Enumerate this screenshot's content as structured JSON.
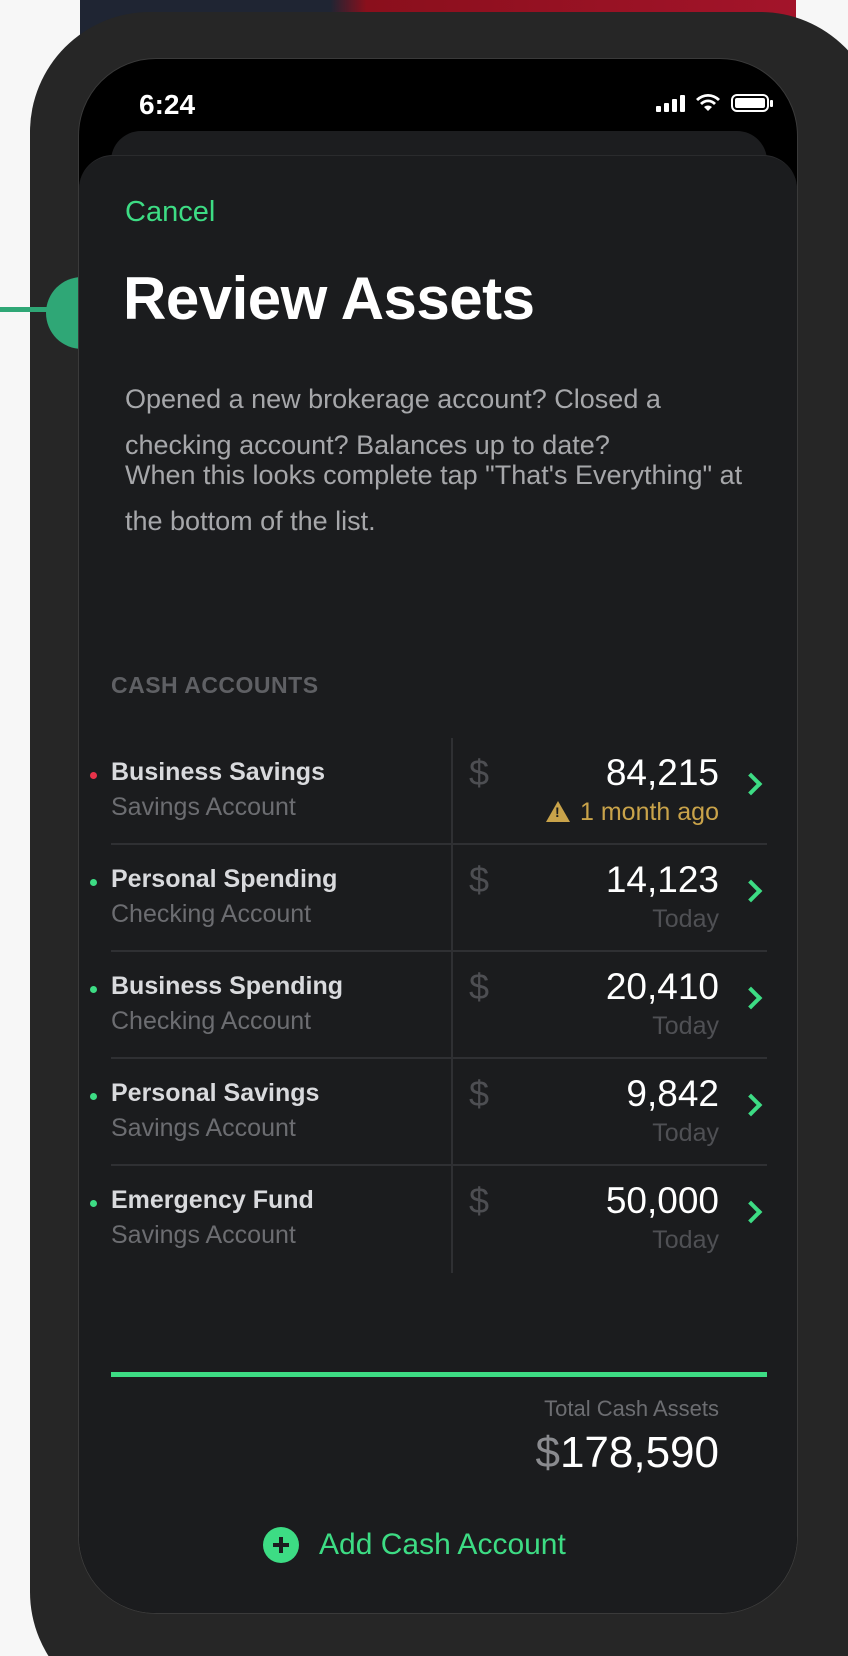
{
  "status_bar": {
    "time": "6:24"
  },
  "nav": {
    "cancel_label": "Cancel"
  },
  "page": {
    "title": "Review Assets",
    "description_1": "Opened a new brokerage account? Closed a checking account? Balances up to date?",
    "description_2": "When this looks complete tap \"That's Everything\" at the bottom of the list."
  },
  "cash_accounts": {
    "header": "CASH ACCOUNTS",
    "currency_symbol": "$",
    "items": [
      {
        "name": "Business Savings",
        "type": "Savings Account",
        "amount": "84,215",
        "updated": "1 month ago",
        "stale": true,
        "bullet_color": "#e8334a"
      },
      {
        "name": "Personal Spending",
        "type": "Checking Account",
        "amount": "14,123",
        "updated": "Today",
        "stale": false,
        "bullet_color": "#3ddc84"
      },
      {
        "name": "Business Spending",
        "type": "Checking Account",
        "amount": "20,410",
        "updated": "Today",
        "stale": false,
        "bullet_color": "#3ddc84"
      },
      {
        "name": "Personal Savings",
        "type": "Savings Account",
        "amount": "9,842",
        "updated": "Today",
        "stale": false,
        "bullet_color": "#3ddc84"
      },
      {
        "name": "Emergency Fund",
        "type": "Savings Account",
        "amount": "50,000",
        "updated": "Today",
        "stale": false,
        "bullet_color": "#3ddc84"
      }
    ],
    "total_label": "Total Cash Assets",
    "total_currency": "$",
    "total_value": "178,590",
    "add_label": "Add Cash Account"
  },
  "colors": {
    "accent": "#3ddc84",
    "warning": "#c9a34a",
    "indicator": "#2fa776"
  }
}
